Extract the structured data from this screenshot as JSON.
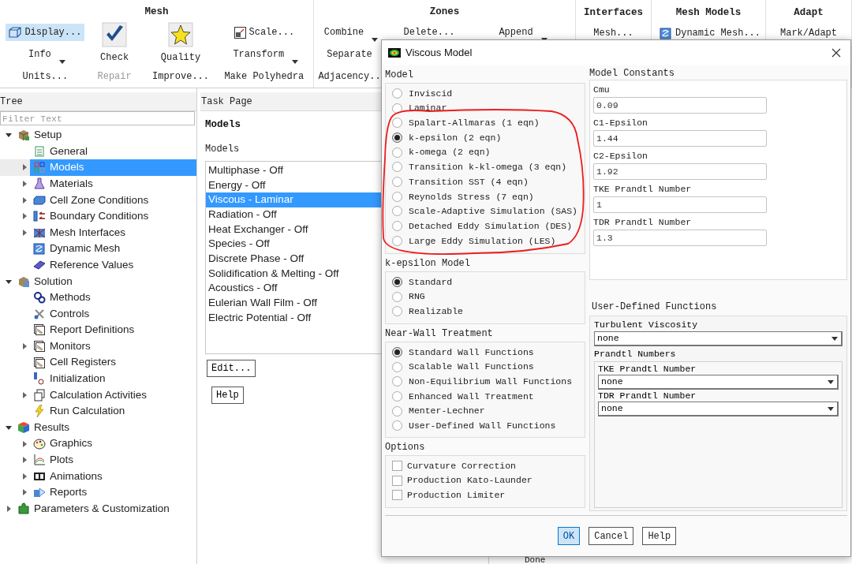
{
  "ribbon": {
    "groups": [
      {
        "title": "Mesh",
        "columns": [
          [
            {
              "label": "Display...",
              "kind": "small",
              "highlighted": true
            },
            {
              "label": "Info",
              "kind": "small",
              "has_menu": true
            },
            {
              "label": "Units...",
              "kind": "small"
            }
          ],
          [
            {
              "label": "Check",
              "kind": "large"
            },
            {
              "label": "Repair",
              "kind": "small",
              "disabled": true
            }
          ],
          [
            {
              "label": "Quality",
              "kind": "large"
            },
            {
              "label": "Improve...",
              "kind": "small"
            }
          ],
          [
            {
              "label": "Scale...",
              "kind": "small"
            },
            {
              "label": "Transform",
              "kind": "small",
              "has_menu": true
            },
            {
              "label": "Make Polyhedra",
              "kind": "small"
            }
          ]
        ]
      },
      {
        "title": "Zones",
        "columns": [
          [
            {
              "label": "Combine",
              "kind": "small",
              "has_menu": true
            },
            {
              "label": "Separate",
              "kind": "small"
            },
            {
              "label": "Adjacency..",
              "kind": "small"
            }
          ],
          [
            {
              "label": "Delete...",
              "kind": "small"
            }
          ],
          [
            {
              "label": "Append",
              "kind": "small",
              "has_menu": true
            }
          ]
        ]
      },
      {
        "title": "Interfaces",
        "columns": [
          [
            {
              "label": "Mesh...",
              "kind": "small"
            }
          ]
        ]
      },
      {
        "title": "Mesh Models",
        "columns": [
          [
            {
              "label": "Dynamic Mesh...",
              "kind": "small"
            }
          ]
        ]
      },
      {
        "title": "Adapt",
        "columns": [
          [
            {
              "label": "Mark/Adapt",
              "kind": "small"
            }
          ]
        ]
      }
    ]
  },
  "tree": {
    "title": "Tree",
    "filter_placeholder": "Filter Text",
    "items": [
      {
        "label": "Setup",
        "expanded": true,
        "selected": false,
        "children": [
          {
            "label": "General",
            "selected": false
          },
          {
            "label": "Models",
            "expanded": false,
            "selected": true
          },
          {
            "label": "Materials",
            "expanded": false,
            "selected": false
          },
          {
            "label": "Cell Zone Conditions",
            "expanded": false,
            "selected": false
          },
          {
            "label": "Boundary Conditions",
            "expanded": false,
            "selected": false
          },
          {
            "label": "Mesh Interfaces",
            "expanded": false,
            "selected": false
          },
          {
            "label": "Dynamic Mesh",
            "selected": false
          },
          {
            "label": "Reference Values",
            "selected": false
          }
        ]
      },
      {
        "label": "Solution",
        "expanded": true,
        "selected": false,
        "children": [
          {
            "label": "Methods",
            "selected": false
          },
          {
            "label": "Controls",
            "selected": false
          },
          {
            "label": "Report Definitions",
            "selected": false
          },
          {
            "label": "Monitors",
            "expanded": false,
            "selected": false
          },
          {
            "label": "Cell Registers",
            "selected": false
          },
          {
            "label": "Initialization",
            "selected": false
          },
          {
            "label": "Calculation Activities",
            "expanded": false,
            "selected": false
          },
          {
            "label": "Run Calculation",
            "selected": false
          }
        ]
      },
      {
        "label": "Results",
        "expanded": true,
        "selected": false,
        "children": [
          {
            "label": "Graphics",
            "expanded": false,
            "selected": false
          },
          {
            "label": "Plots",
            "expanded": false,
            "selected": false
          },
          {
            "label": "Animations",
            "expanded": false,
            "selected": false
          },
          {
            "label": "Reports",
            "expanded": false,
            "selected": false
          }
        ]
      },
      {
        "label": "Parameters & Customization",
        "expanded": false,
        "selected": false
      }
    ]
  },
  "task_page": {
    "header": "Task Page",
    "title": "Models",
    "list_label": "Models",
    "items": [
      {
        "label": "Multiphase - Off",
        "selected": false
      },
      {
        "label": "Energy - Off",
        "selected": false
      },
      {
        "label": "Viscous - Laminar",
        "selected": true
      },
      {
        "label": "Radiation - Off",
        "selected": false
      },
      {
        "label": "Heat Exchanger - Off",
        "selected": false
      },
      {
        "label": "Species - Off",
        "selected": false
      },
      {
        "label": "Discrete Phase - Off",
        "selected": false
      },
      {
        "label": "Solidification & Melting - Off",
        "selected": false
      },
      {
        "label": "Acoustics - Off",
        "selected": false
      },
      {
        "label": "Eulerian Wall Film - Off",
        "selected": false
      },
      {
        "label": "Electric Potential - Off",
        "selected": false
      }
    ],
    "buttons": [
      "Edit...",
      "Help"
    ]
  },
  "console": {
    "last_line": "Done"
  },
  "dialog": {
    "title": "Viscous Model",
    "model": {
      "label": "Model",
      "options": [
        {
          "label": "Inviscid",
          "selected": false
        },
        {
          "label": "Laminar",
          "selected": false
        },
        {
          "label": "Spalart-Allmaras (1 eqn)",
          "selected": false
        },
        {
          "label": "k-epsilon (2 eqn)",
          "selected": true
        },
        {
          "label": "k-omega (2 eqn)",
          "selected": false
        },
        {
          "label": "Transition k-kl-omega (3 eqn)",
          "selected": false
        },
        {
          "label": "Transition SST (4 eqn)",
          "selected": false
        },
        {
          "label": "Reynolds Stress (7 eqn)",
          "selected": false
        },
        {
          "label": "Scale-Adaptive Simulation (SAS)",
          "selected": false
        },
        {
          "label": "Detached Eddy Simulation (DES)",
          "selected": false
        },
        {
          "label": "Large Eddy Simulation (LES)",
          "selected": false
        }
      ]
    },
    "k_epsilon_model": {
      "label": "k-epsilon Model",
      "options": [
        {
          "label": "Standard",
          "selected": true
        },
        {
          "label": "RNG",
          "selected": false
        },
        {
          "label": "Realizable",
          "selected": false
        }
      ]
    },
    "near_wall_treatment": {
      "label": "Near-Wall Treatment",
      "options": [
        {
          "label": "Standard Wall Functions",
          "selected": true
        },
        {
          "label": "Scalable Wall Functions",
          "selected": false
        },
        {
          "label": "Non-Equilibrium Wall Functions",
          "selected": false
        },
        {
          "label": "Enhanced Wall Treatment",
          "selected": false
        },
        {
          "label": "Menter-Lechner",
          "selected": false
        },
        {
          "label": "User-Defined Wall Functions",
          "selected": false
        }
      ]
    },
    "options": {
      "label": "Options",
      "items": [
        {
          "label": "Curvature Correction",
          "checked": false
        },
        {
          "label": "Production Kato-Launder",
          "checked": false
        },
        {
          "label": "Production Limiter",
          "checked": false
        }
      ]
    },
    "model_constants": {
      "label": "Model Constants",
      "fields": [
        {
          "label": "Cmu",
          "value": "0.09"
        },
        {
          "label": "C1-Epsilon",
          "value": "1.44"
        },
        {
          "label": "C2-Epsilon",
          "value": "1.92"
        },
        {
          "label": "TKE Prandtl Number",
          "value": "1"
        },
        {
          "label": "TDR Prandtl Number",
          "value": "1.3"
        }
      ]
    },
    "user_defined_functions": {
      "label": "User-Defined Functions",
      "turbulent_viscosity": {
        "label": "Turbulent Viscosity",
        "value": "none"
      },
      "prandtl_numbers": {
        "label": "Prandtl Numbers",
        "fields": [
          {
            "label": "TKE Prandtl Number",
            "value": "none"
          },
          {
            "label": "TDR Prandtl Number",
            "value": "none"
          }
        ]
      }
    },
    "buttons": [
      {
        "label": "OK",
        "selected": true
      },
      {
        "label": "Cancel",
        "selected": false
      },
      {
        "label": "Help",
        "selected": false
      }
    ]
  }
}
